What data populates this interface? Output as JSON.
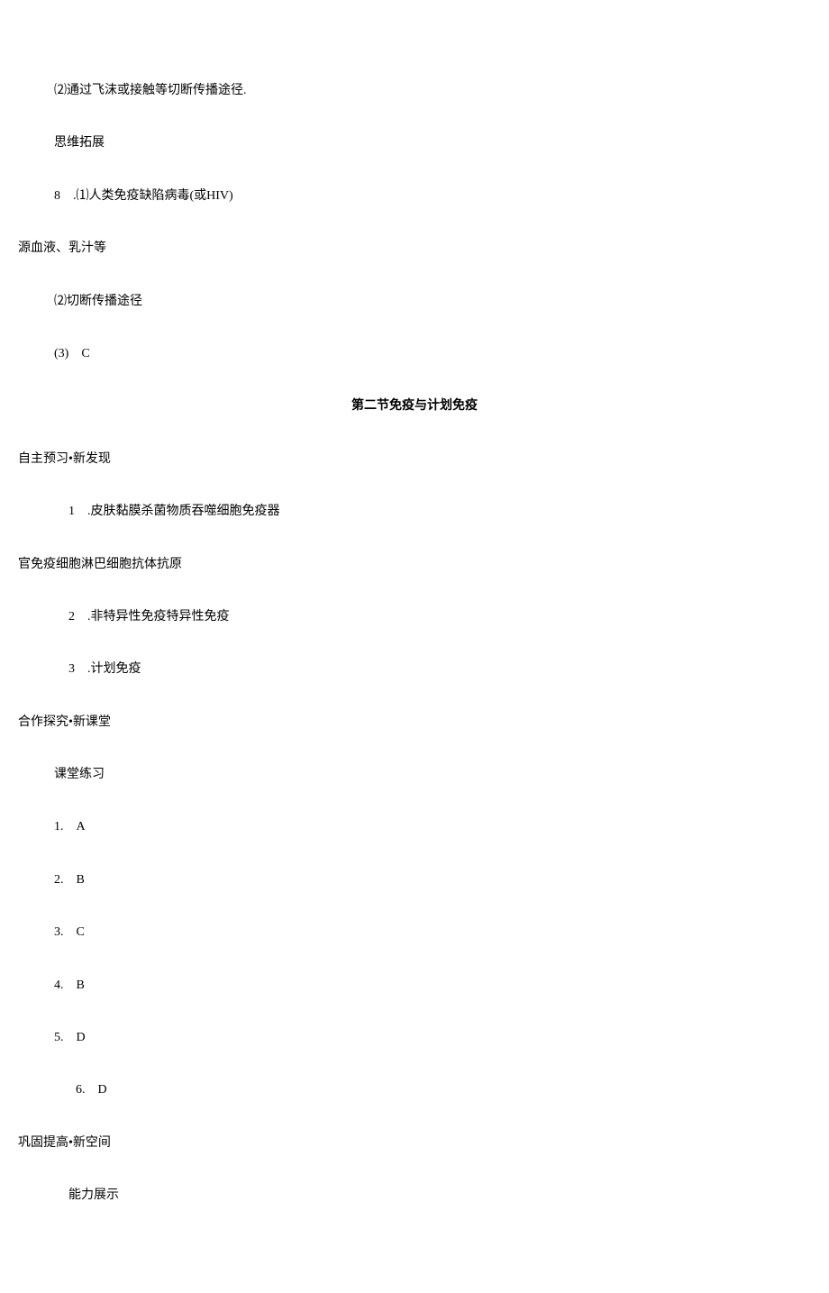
{
  "lines": {
    "l1": "⑵通过飞沫或接触等切断传播途径.",
    "l2": "思维拓展",
    "l3": "8　.⑴人类免疫缺陷病毒(或HIV)",
    "l4": "源血液、乳汁等",
    "l5": "⑵切断传播途径",
    "l6": "(3)　C",
    "section_title": "第二节免疫与计划免疫",
    "l7": "自主预习•新发现",
    "l8": "1　.皮肤黏膜杀菌物质吞噬细胞免疫器",
    "l9": "官免疫细胞淋巴细胞抗体抗原",
    "l10": "2　.非特异性免疫特异性免疫",
    "l11": "3　.计划免疫",
    "l12": "合作探究•新课堂",
    "l13": "课堂练习",
    "a1": "1.　A",
    "a2": "2.　B",
    "a3": "3.　C",
    "a4": "4.　B",
    "a5": "5.　D",
    "a6": "6.　D",
    "l14": "巩固提高•新空间",
    "l15": "能力展示"
  }
}
